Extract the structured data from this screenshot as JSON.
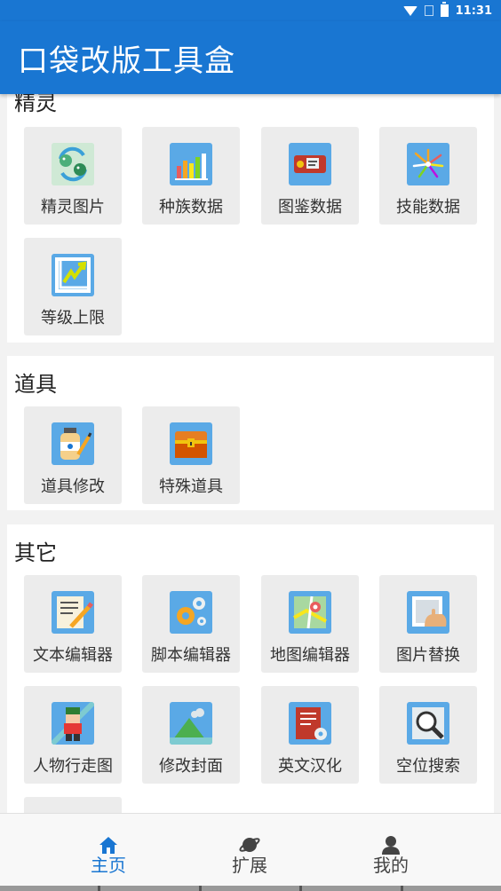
{
  "status_bar": {
    "time": "11:31"
  },
  "app_bar": {
    "title": "口袋改版工具盒"
  },
  "sections": [
    {
      "title": "精灵",
      "items": [
        "精灵图片",
        "种族数据",
        "图鉴数据",
        "技能数据",
        "等级上限"
      ]
    },
    {
      "title": "道具",
      "items": [
        "道具修改",
        "特殊道具"
      ]
    },
    {
      "title": "其它",
      "items": [
        "文本编辑器",
        "脚本编辑器",
        "地图编辑器",
        "图片替换",
        "人物行走图",
        "修改封面",
        "英文汉化",
        "空位搜索"
      ]
    }
  ],
  "bottom_nav": {
    "items": [
      "主页",
      "扩展",
      "我的"
    ],
    "active": 0
  },
  "colors": {
    "primary": "#1976d2",
    "tile_bg": "#ececec",
    "icon_bg": "#5aa9e6"
  },
  "icons": [
    "pokemon-sprite-icon",
    "bar-chart-icon",
    "pokedex-icon",
    "fireworks-icon",
    "level-up-chart-icon",
    "potion-jar-icon",
    "treasure-chest-icon",
    "text-edit-icon",
    "gears-icon",
    "map-icon",
    "image-replace-icon",
    "trainer-sprite-icon",
    "landscape-icon",
    "list-settings-icon",
    "magnifier-icon"
  ]
}
